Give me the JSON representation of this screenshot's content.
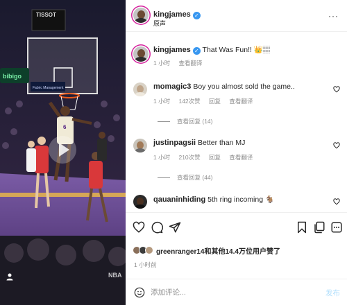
{
  "media": {
    "scoreboard_brand": "TISSOT",
    "sponsor_sign": "bibigo",
    "board_sign": "Fabric Management",
    "jersey_number": "6",
    "watermark": "NBA",
    "play_icon": "play-icon",
    "tag_icon": "user-tag-icon"
  },
  "header": {
    "username": "kingjames",
    "sublabel": "原声",
    "more_icon": "more-icon"
  },
  "caption": {
    "username": "kingjames",
    "text": "That Was Fun!! 👑🏽",
    "time": "1 小时",
    "translate": "查看翻译"
  },
  "comments": [
    {
      "username": "momagic3",
      "text": "Boy you almost sold the game..",
      "time": "1 小时",
      "likes": "142次赞",
      "reply": "回复",
      "translate": "查看翻译",
      "view_replies": "查看回复 (14)"
    },
    {
      "username": "justinpagsii",
      "text": "Better than MJ",
      "time": "1 小时",
      "likes": "210次赞",
      "reply": "回复",
      "translate": "查看翻译",
      "view_replies": "查看回复 (44)"
    },
    {
      "username": "qauaninhiding",
      "text": "5th ring incoming 🐐",
      "time": "",
      "likes": "",
      "reply": "",
      "translate": "",
      "view_replies": ""
    }
  ],
  "actions": {
    "like_icon": "heart-icon",
    "comment_icon": "comment-icon",
    "share_icon": "send-icon",
    "save_icon": "bookmark-icon",
    "copy_icon": "reels-icon",
    "more_icon": "more-icon"
  },
  "likes_line": {
    "user": "greenranger14",
    "rest": "和其他14.4万位用户赞了"
  },
  "time_ago": "1 小时前",
  "comment_box": {
    "placeholder": "添加评论...",
    "post_label": "发布",
    "emoji_icon": "emoji-icon"
  },
  "colors": {
    "accent": "#3897f0",
    "post_disabled": "#b2dffc",
    "court_purple": "#4a2a6e",
    "court_gold": "#e8b64a",
    "text_secondary": "#8e8e8e"
  }
}
